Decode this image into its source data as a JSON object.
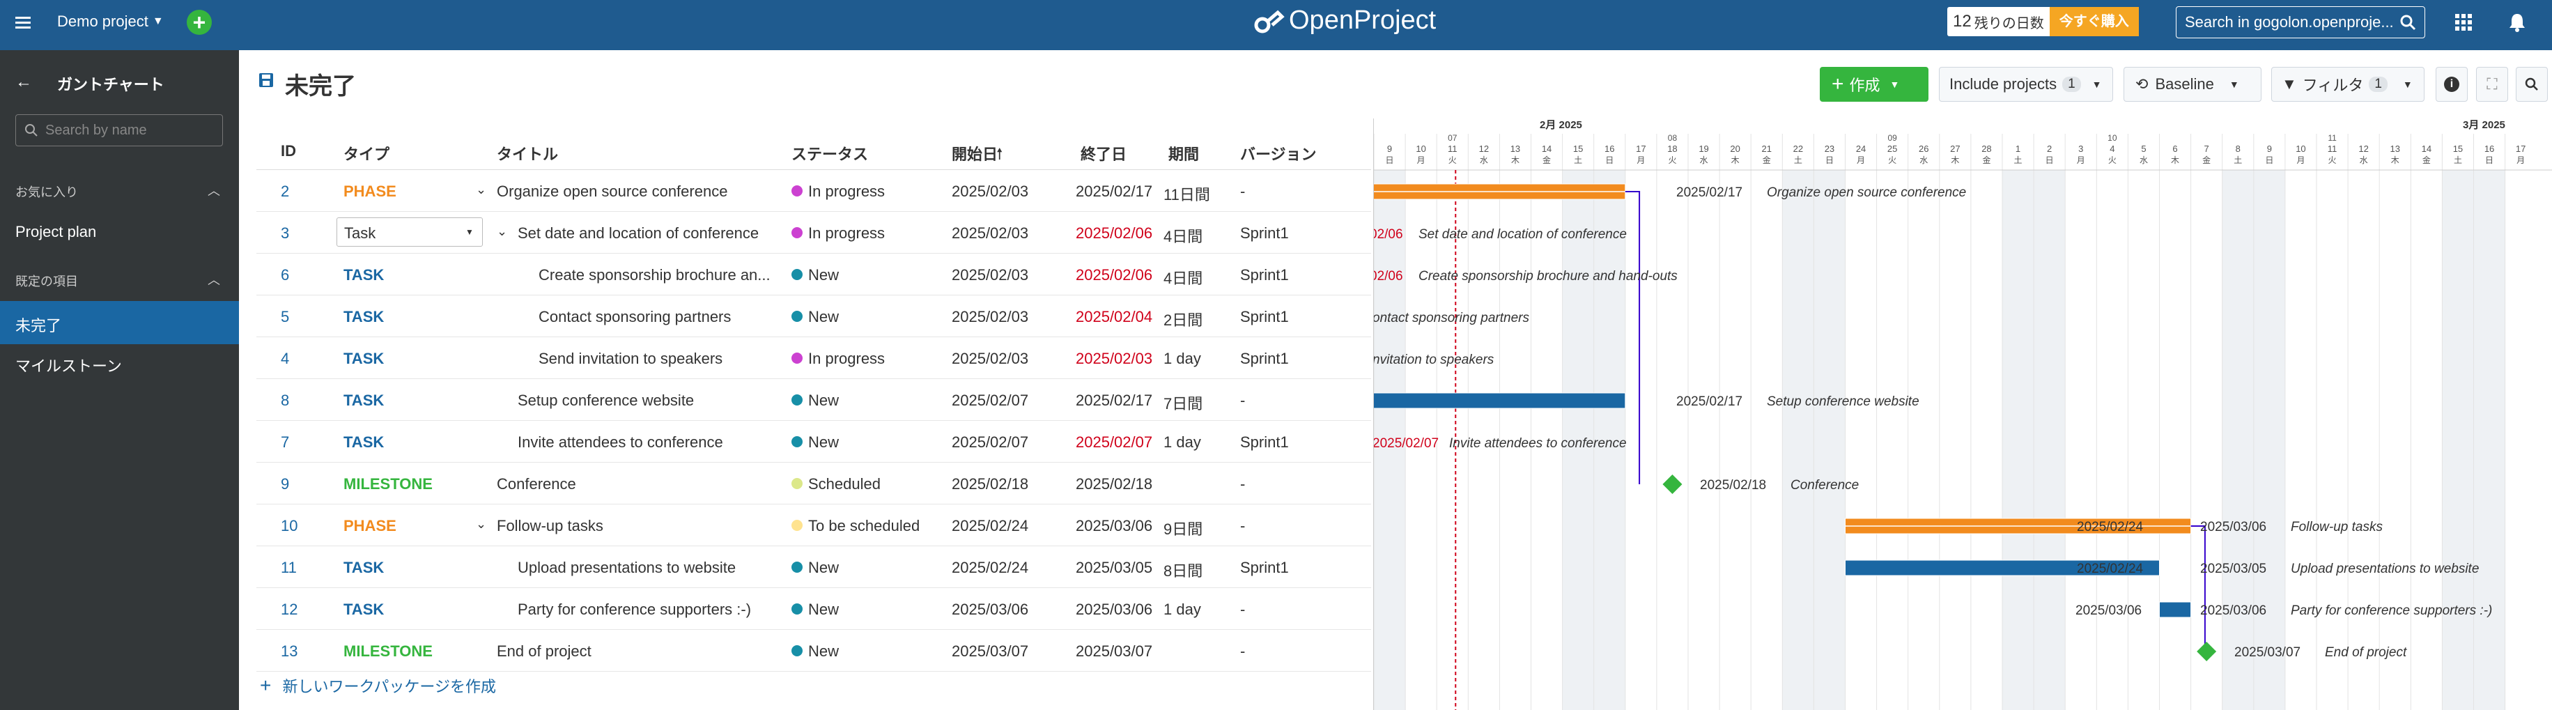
{
  "header": {
    "project": "Demo project",
    "logo": "OpenProject",
    "trial_days": "12",
    "trial_text": "残りの日数",
    "trial_button": "今すぐ購入",
    "search_placeholder": "Search in gogolon.openproje..."
  },
  "sidebar": {
    "title": "ガントチャート",
    "search_placeholder": "Search by name",
    "favorites_label": "お気に入り",
    "favorite_item": "Project plan",
    "default_label": "既定の項目",
    "items": [
      "未完了",
      "マイルストーン"
    ]
  },
  "toolbar": {
    "page_title": "未完了",
    "create_label": "作成",
    "include_label": "Include projects",
    "include_count": "1",
    "baseline_label": "Baseline",
    "filter_label": "フィルタ",
    "filter_count": "1"
  },
  "table": {
    "headers": [
      "ID",
      "タイプ",
      "タイトル",
      "ステータス",
      "開始日",
      "終了日",
      "期間",
      "バージョン"
    ],
    "rows": [
      {
        "id": "2",
        "type": "PHASE",
        "title": "Organize open source conference",
        "status": "In progress",
        "start": "2025/02/03",
        "end": "2025/02/17",
        "duration": "11日間",
        "version": "-",
        "indent": 0,
        "expand": true,
        "end_red": false
      },
      {
        "id": "3",
        "type": "Task",
        "title": "Set date and location of conference",
        "status": "In progress",
        "start": "2025/02/03",
        "end": "2025/02/06",
        "duration": "4日間",
        "version": "Sprint1",
        "indent": 1,
        "expand": true,
        "end_red": true,
        "select": true
      },
      {
        "id": "6",
        "type": "TASK",
        "title": "Create sponsorship brochure an...",
        "status": "New",
        "start": "2025/02/03",
        "end": "2025/02/06",
        "duration": "4日間",
        "version": "Sprint1",
        "indent": 2,
        "end_red": true
      },
      {
        "id": "5",
        "type": "TASK",
        "title": "Contact sponsoring partners",
        "status": "New",
        "start": "2025/02/03",
        "end": "2025/02/04",
        "duration": "2日間",
        "version": "Sprint1",
        "indent": 2,
        "end_red": true
      },
      {
        "id": "4",
        "type": "TASK",
        "title": "Send invitation to speakers",
        "status": "In progress",
        "start": "2025/02/03",
        "end": "2025/02/03",
        "duration": "1 day",
        "version": "Sprint1",
        "indent": 2,
        "end_red": true
      },
      {
        "id": "8",
        "type": "TASK",
        "title": "Setup conference website",
        "status": "New",
        "start": "2025/02/07",
        "end": "2025/02/17",
        "duration": "7日間",
        "version": "-",
        "indent": 1,
        "end_red": false
      },
      {
        "id": "7",
        "type": "TASK",
        "title": "Invite attendees to conference",
        "status": "New",
        "start": "2025/02/07",
        "end": "2025/02/07",
        "duration": "1 day",
        "version": "Sprint1",
        "indent": 1,
        "end_red": true
      },
      {
        "id": "9",
        "type": "MILESTONE",
        "title": "Conference",
        "status": "Scheduled",
        "start": "2025/02/18",
        "end": "2025/02/18",
        "duration": "",
        "version": "-",
        "indent": 0,
        "end_red": false
      },
      {
        "id": "10",
        "type": "PHASE",
        "title": "Follow-up tasks",
        "status": "To be scheduled",
        "start": "2025/02/24",
        "end": "2025/03/06",
        "duration": "9日間",
        "version": "-",
        "indent": 0,
        "expand": true,
        "end_red": false
      },
      {
        "id": "11",
        "type": "TASK",
        "title": "Upload presentations to website",
        "status": "New",
        "start": "2025/02/24",
        "end": "2025/03/05",
        "duration": "8日間",
        "version": "Sprint1",
        "indent": 1,
        "end_red": false
      },
      {
        "id": "12",
        "type": "TASK",
        "title": "Party for conference supporters :-)",
        "status": "New",
        "start": "2025/03/06",
        "end": "2025/03/06",
        "duration": "1 day",
        "version": "-",
        "indent": 1,
        "end_red": false
      },
      {
        "id": "13",
        "type": "MILESTONE",
        "title": "End of project",
        "status": "New",
        "start": "2025/03/07",
        "end": "2025/03/07",
        "duration": "",
        "version": "-",
        "indent": 0,
        "end_red": false
      }
    ],
    "create_link": "新しいワークパッケージを作成"
  },
  "colors": {
    "PHASE": "#f28b1e",
    "TASK": "#1a67a3",
    "Task": "#1a67a3",
    "MILESTONE": "#35b53e",
    "In progress": "#cc41d1",
    "New": "#178fa7",
    "Scheduled": "#dce88a",
    "To be scheduled": "#ffe38f"
  },
  "gantt": {
    "month1": "2月 2025",
    "month2": "3月 2025",
    "labels": [
      {
        "left": "",
        "right": "2025/02/17",
        "name": "Organize open source conference"
      },
      {
        "left": "02/06",
        "right": "",
        "name": "Set date and location of conference",
        "red": true
      },
      {
        "left": "02/06",
        "right": "",
        "name": "Create sponsorship brochure and hand-outs",
        "red": true
      },
      {
        "left": "",
        "right": "",
        "name": "ontact sponsoring partners"
      },
      {
        "left": "",
        "right": "",
        "name": "nvitation to speakers"
      },
      {
        "left": "",
        "right": "2025/02/17",
        "name": "Setup conference website"
      },
      {
        "left": "2025/02/07",
        "right": "",
        "name": "Invite attendees to conference",
        "red": true
      },
      {
        "left": "",
        "right": "2025/02/18",
        "name": "Conference"
      },
      {
        "left": "2025/02/24",
        "right": "2025/03/06",
        "name": "Follow-up tasks"
      },
      {
        "left": "2025/02/24",
        "right": "2025/03/05",
        "name": "Upload presentations to website"
      },
      {
        "left": "2025/03/06",
        "right": "2025/03/06",
        "name": "Party for conference supporters :-)"
      },
      {
        "left": "",
        "right": "2025/03/07",
        "name": "End of project"
      }
    ],
    "days": [
      "9",
      "10",
      "11",
      "12",
      "13",
      "14",
      "15",
      "16",
      "17",
      "18",
      "19",
      "20",
      "21",
      "22",
      "23",
      "24",
      "25",
      "26",
      "27",
      "28",
      "1",
      "2",
      "3",
      "4",
      "5",
      "6",
      "7",
      "8",
      "9",
      "10",
      "11",
      "12",
      "13",
      "14",
      "15",
      "16",
      "17"
    ],
    "dows": [
      "日",
      "月",
      "火",
      "水",
      "木",
      "金",
      "土",
      "日",
      "月",
      "火",
      "水",
      "木",
      "金",
      "土",
      "日",
      "月",
      "火",
      "水",
      "木",
      "金",
      "土",
      "日",
      "月",
      "火",
      "水",
      "木",
      "金",
      "土",
      "日",
      "月",
      "火",
      "水",
      "木",
      "金",
      "土",
      "日",
      "月"
    ],
    "weeks": [
      "07",
      "08",
      "09",
      "10",
      "11"
    ]
  }
}
